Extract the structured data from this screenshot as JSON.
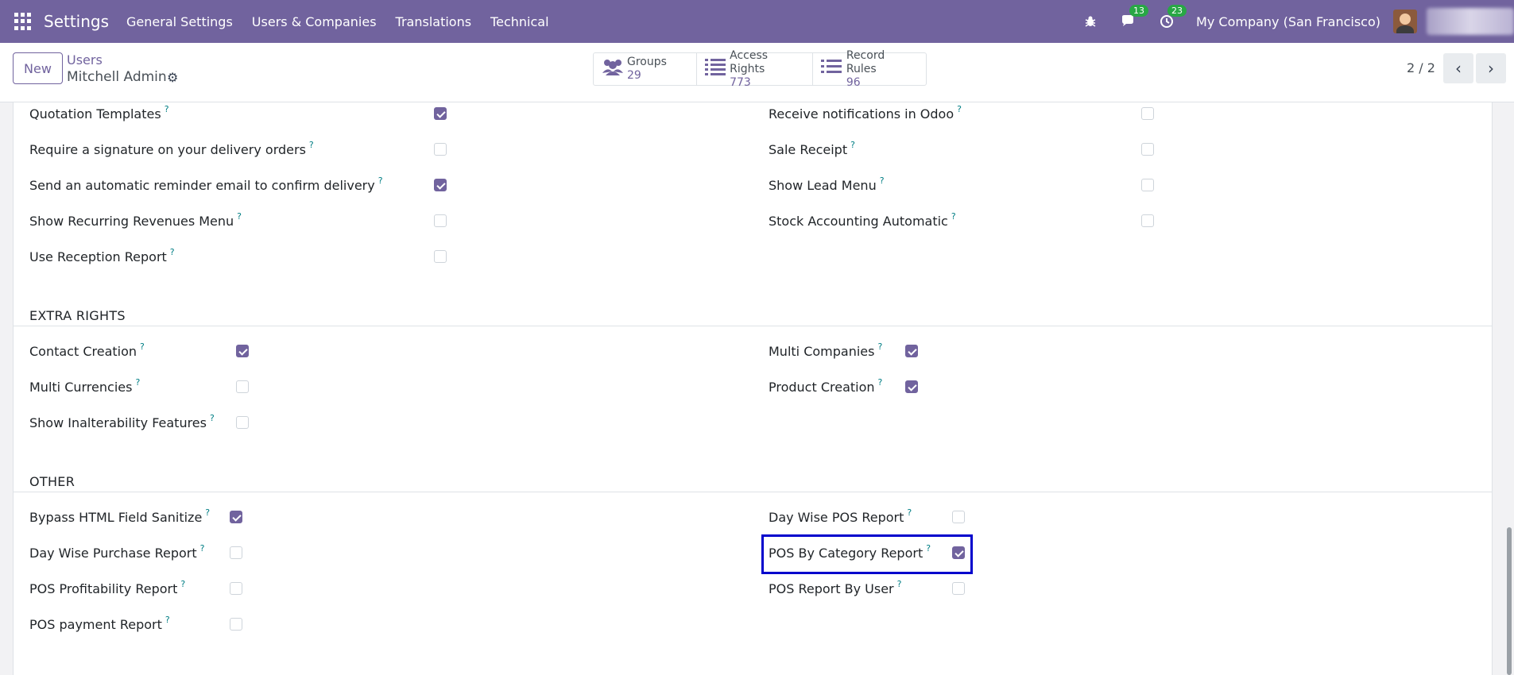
{
  "topnav": {
    "brand": "Settings",
    "menu": [
      "General Settings",
      "Users & Companies",
      "Translations",
      "Technical"
    ],
    "messages_badge": "13",
    "activities_badge": "23",
    "company": "My Company (San Francisco)"
  },
  "control": {
    "new_label": "New",
    "breadcrumb_parent": "Users",
    "breadcrumb_current": "Mitchell Admin",
    "stats": [
      {
        "label": "Groups",
        "value": "29",
        "icon": "users-icon"
      },
      {
        "label": "Access Rights",
        "value": "773",
        "icon": "list-icon"
      },
      {
        "label": "Record Rules",
        "value": "96",
        "icon": "list-icon"
      }
    ],
    "pager": "2 / 2"
  },
  "sections": {
    "top": {
      "left": [
        {
          "label": "Quotation Templates",
          "checked": true
        },
        {
          "label": "Require a signature on your delivery orders",
          "checked": false
        },
        {
          "label": "Send an automatic reminder email to confirm delivery",
          "checked": true
        },
        {
          "label": "Show Recurring Revenues Menu",
          "checked": false
        },
        {
          "label": "Use Reception Report",
          "checked": false
        }
      ],
      "right": [
        {
          "label": "Receive notifications in Odoo",
          "checked": false
        },
        {
          "label": "Sale Receipt",
          "checked": false
        },
        {
          "label": "Show Lead Menu",
          "checked": false
        },
        {
          "label": "Stock Accounting Automatic",
          "checked": false
        }
      ]
    },
    "extra_rights": {
      "title": "EXTRA RIGHTS",
      "left": [
        {
          "label": "Contact Creation",
          "checked": true
        },
        {
          "label": "Multi Currencies",
          "checked": false
        },
        {
          "label": "Show Inalterability Features",
          "checked": false
        }
      ],
      "right": [
        {
          "label": "Multi Companies",
          "checked": true
        },
        {
          "label": "Product Creation",
          "checked": true
        }
      ]
    },
    "other": {
      "title": "OTHER",
      "left": [
        {
          "label": "Bypass HTML Field Sanitize",
          "checked": true
        },
        {
          "label": "Day Wise Purchase Report",
          "checked": false
        },
        {
          "label": "POS Profitability Report",
          "checked": false
        },
        {
          "label": "POS payment Report",
          "checked": false
        }
      ],
      "right": [
        {
          "label": "Day Wise POS Report",
          "checked": false
        },
        {
          "label": "POS By Category Report",
          "checked": true
        },
        {
          "label": "POS Report By User",
          "checked": false
        }
      ]
    }
  },
  "help_mark": "?",
  "colors": {
    "brand": "#71639e",
    "highlight": "#0000cc"
  }
}
